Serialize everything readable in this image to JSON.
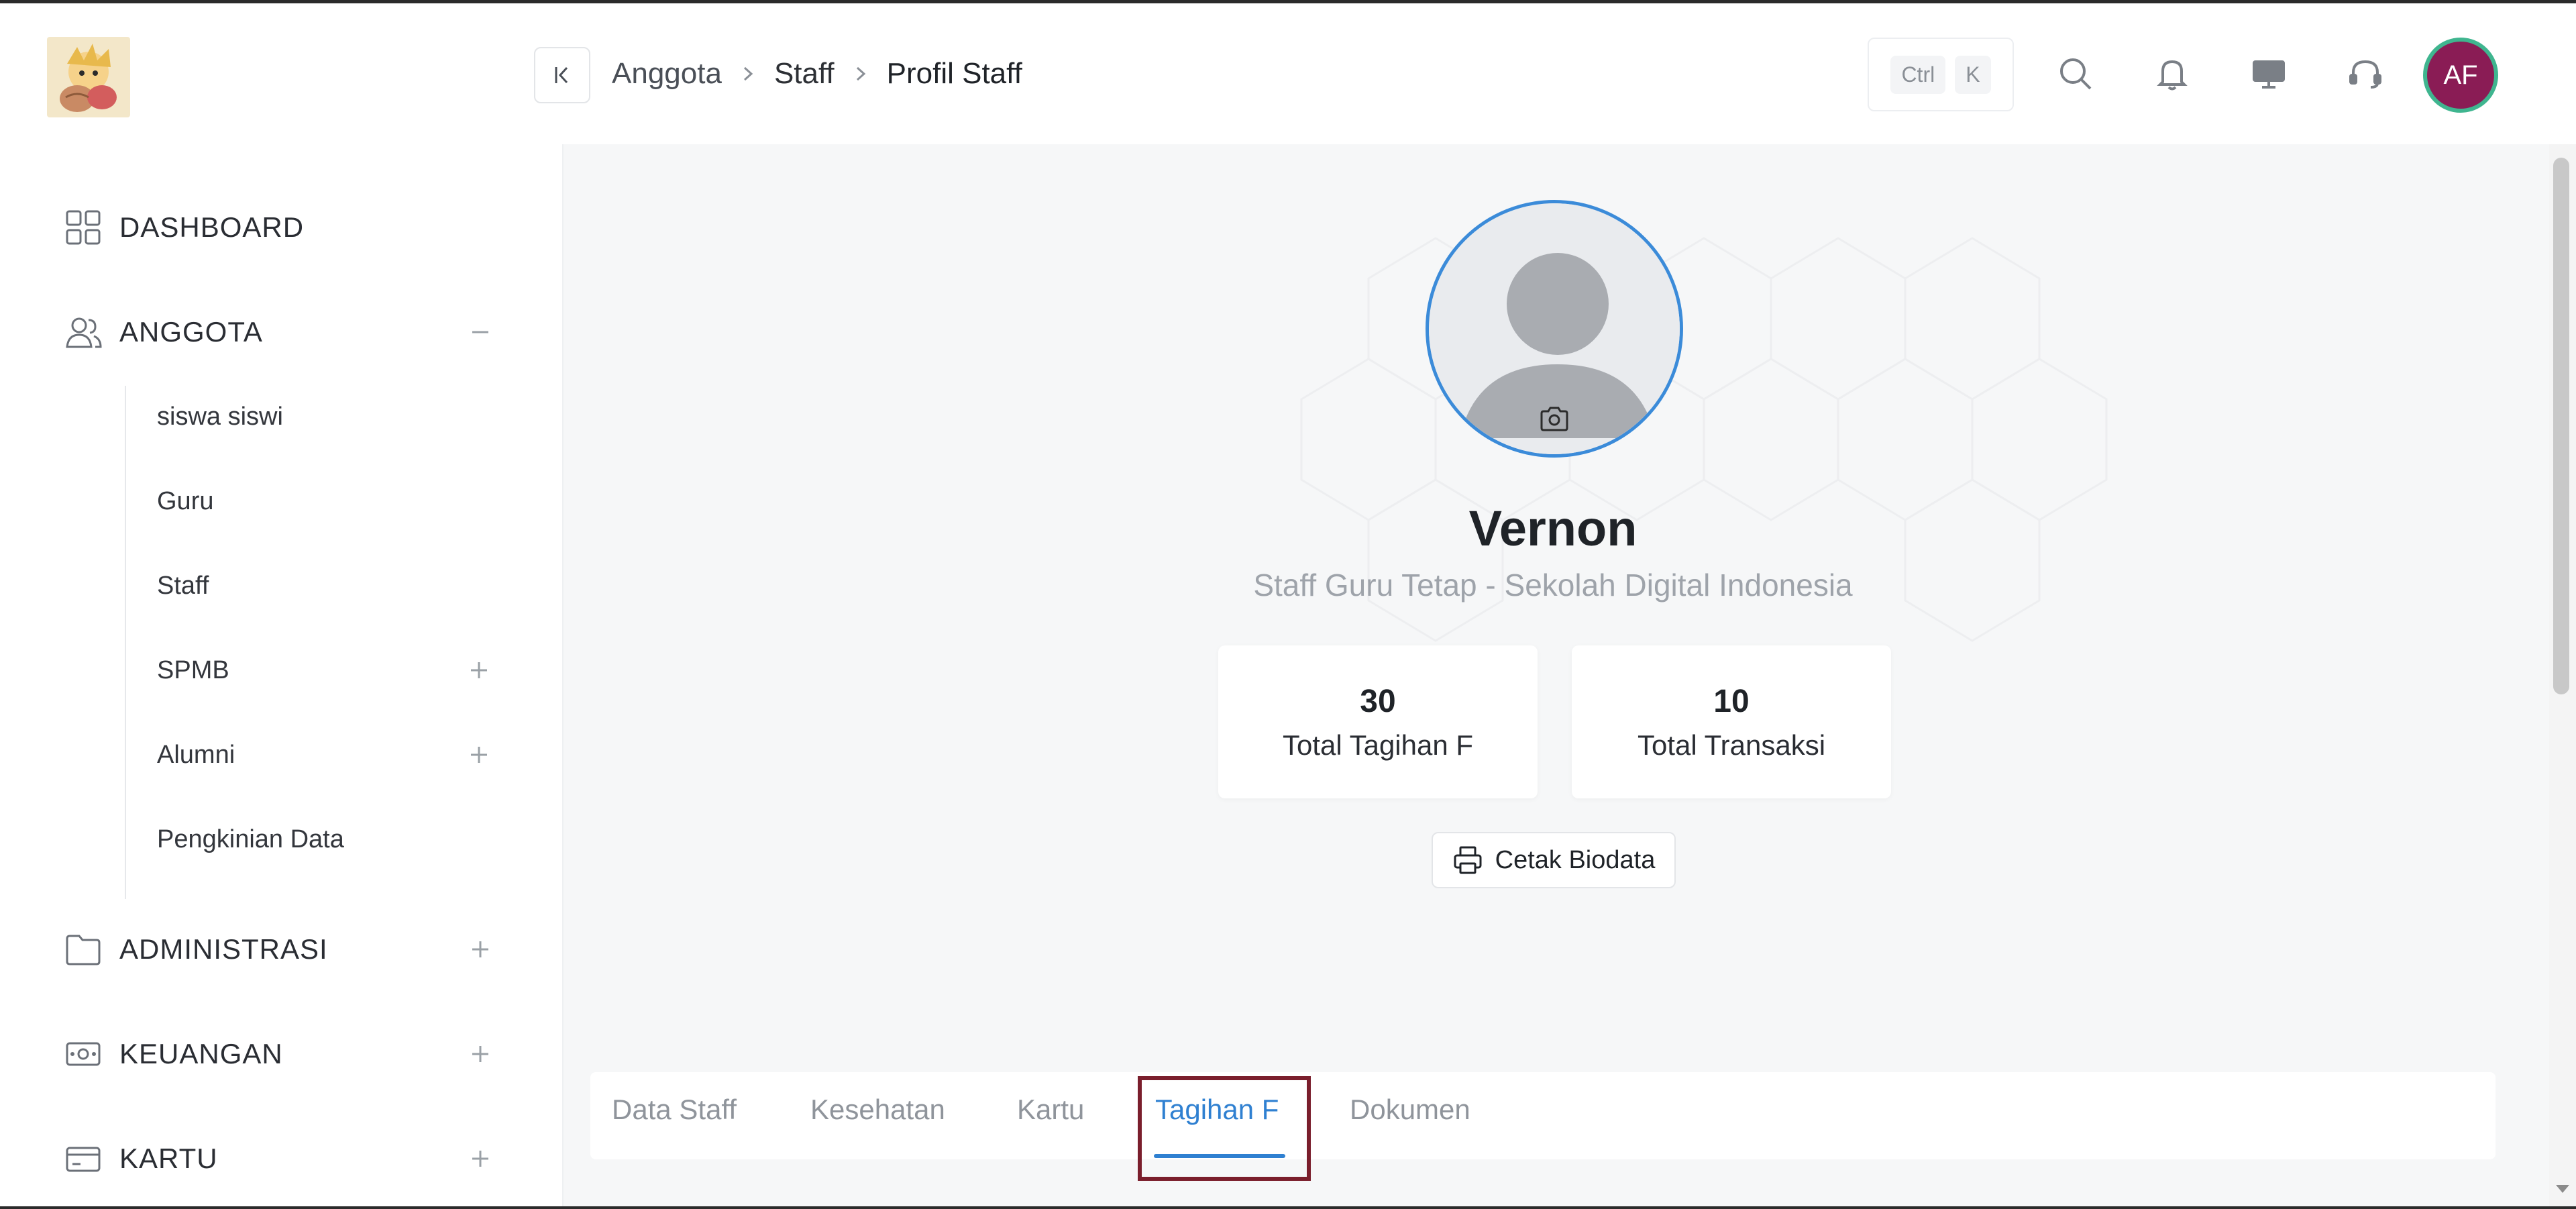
{
  "sidebar": {
    "items": [
      {
        "label": "DASHBOARD"
      },
      {
        "label": "ANGGOTA",
        "toggle": "−"
      },
      {
        "label": "ADMINISTRASI",
        "toggle": "+"
      },
      {
        "label": "KEUANGAN",
        "toggle": "+"
      },
      {
        "label": "KARTU",
        "toggle": "+"
      }
    ],
    "anggota_sub": [
      {
        "label": "siswa siswi"
      },
      {
        "label": "Guru"
      },
      {
        "label": "Staff"
      },
      {
        "label": "SPMB",
        "toggle": "+"
      },
      {
        "label": "Alumni",
        "toggle": "+"
      },
      {
        "label": "Pengkinian Data"
      }
    ]
  },
  "header": {
    "breadcrumb": [
      "Anggota",
      "Staff",
      "Profil Staff"
    ],
    "shortcut": {
      "ctrl": "Ctrl",
      "key": "K"
    },
    "avatar_initials": "AF",
    "icons": [
      "search-icon",
      "bell-icon",
      "monitor-icon",
      "headset-icon"
    ]
  },
  "profile": {
    "name": "Vernon",
    "subtitle": "Staff Guru Tetap - Sekolah Digital Indonesia",
    "stats": [
      {
        "value": "30",
        "label": "Total Tagihan F"
      },
      {
        "value": "10",
        "label": "Total Transaksi"
      }
    ],
    "print_button": "Cetak Biodata"
  },
  "tabs": [
    {
      "label": "Data Staff"
    },
    {
      "label": "Kesehatan"
    },
    {
      "label": "Kartu"
    },
    {
      "label": "Tagihan F",
      "active": true
    },
    {
      "label": "Dokumen"
    }
  ],
  "colors": {
    "accent": "#2f80d1",
    "avatar_bg": "#8a1c55",
    "avatar_ring": "#3fb58f",
    "highlight": "#7a1e2c"
  }
}
